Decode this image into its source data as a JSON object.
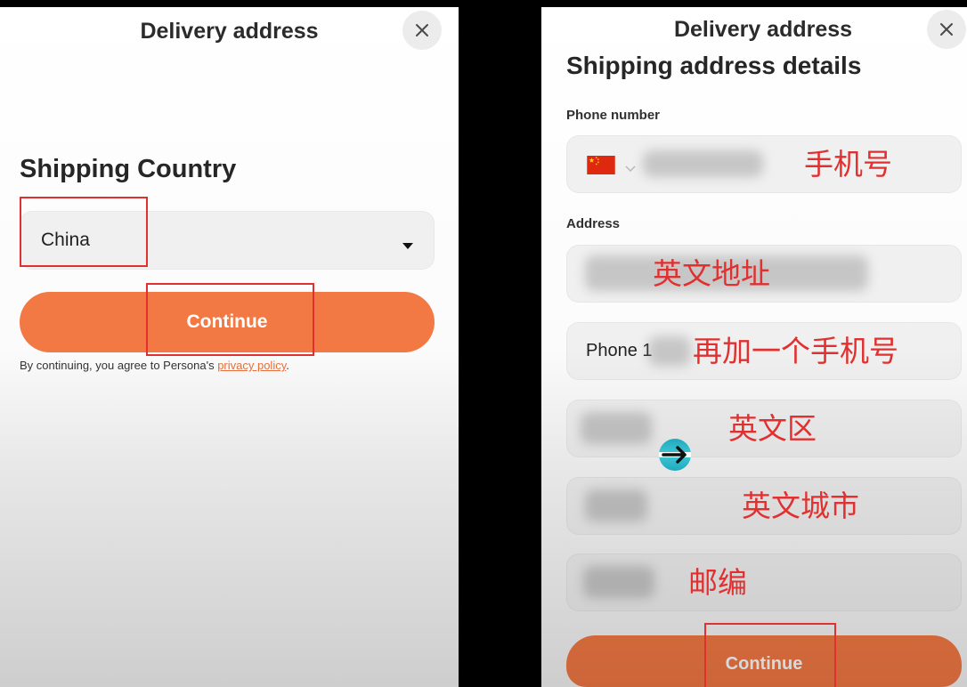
{
  "colors": {
    "accent": "#F37944",
    "annotation": "#E0302F",
    "field_bg": "#F0F0F0",
    "text": "#222222"
  },
  "left_screen": {
    "header": {
      "title": "Delivery address",
      "close_icon": "close-icon"
    },
    "heading": "Shipping Country",
    "country_select": {
      "value": "China",
      "icon": "caret-down-icon"
    },
    "continue_button": {
      "label": "Continue"
    },
    "consent": {
      "prefix": "By continuing, you agree to Persona's ",
      "link": "privacy policy",
      "suffix": "."
    }
  },
  "right_screen": {
    "header": {
      "title": "Delivery address",
      "close_icon": "close-icon"
    },
    "heading": "Shipping address details",
    "phone_section": {
      "label": "Phone number",
      "country_icon": "china-flag-icon",
      "dropdown_icon": "chevron-down-icon",
      "annotation": "手机号"
    },
    "address_section": {
      "label": "Address",
      "fields": [
        {
          "annotation": "英文地址"
        },
        {
          "value": "Phone 1",
          "annotation": "再加一个手机号"
        },
        {
          "annotation": "英文区"
        },
        {
          "annotation": "英文城市"
        },
        {
          "annotation": "邮编"
        }
      ]
    },
    "continue_button": {
      "label": "Continue"
    },
    "overlay_icon": "cursor-arrow-icon"
  }
}
